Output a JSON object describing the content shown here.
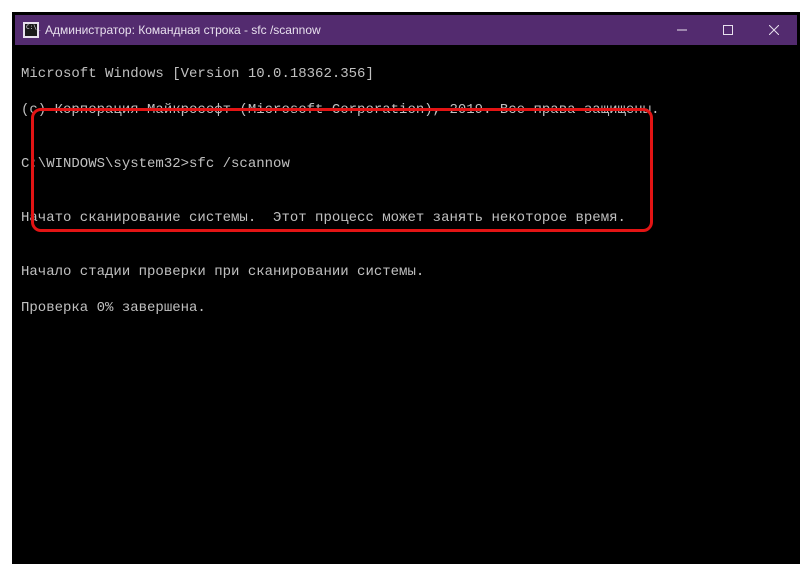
{
  "window": {
    "title": "Администратор: Командная строка - sfc  /scannow"
  },
  "console": {
    "line1": "Microsoft Windows [Version 10.0.18362.356]",
    "line2": "(c) Корпорация Майкрософт (Microsoft Corporation), 2019. Все права защищены.",
    "blank1": "",
    "prompt": "C:\\WINDOWS\\system32>sfc /scannow",
    "blank2": "",
    "scan_started": "Начато сканирование системы.  Этот процесс может занять некоторое время.",
    "blank3": "",
    "scan_stage": "Начало стадии проверки при сканировании системы.",
    "scan_progress": "Проверка 0% завершена."
  }
}
